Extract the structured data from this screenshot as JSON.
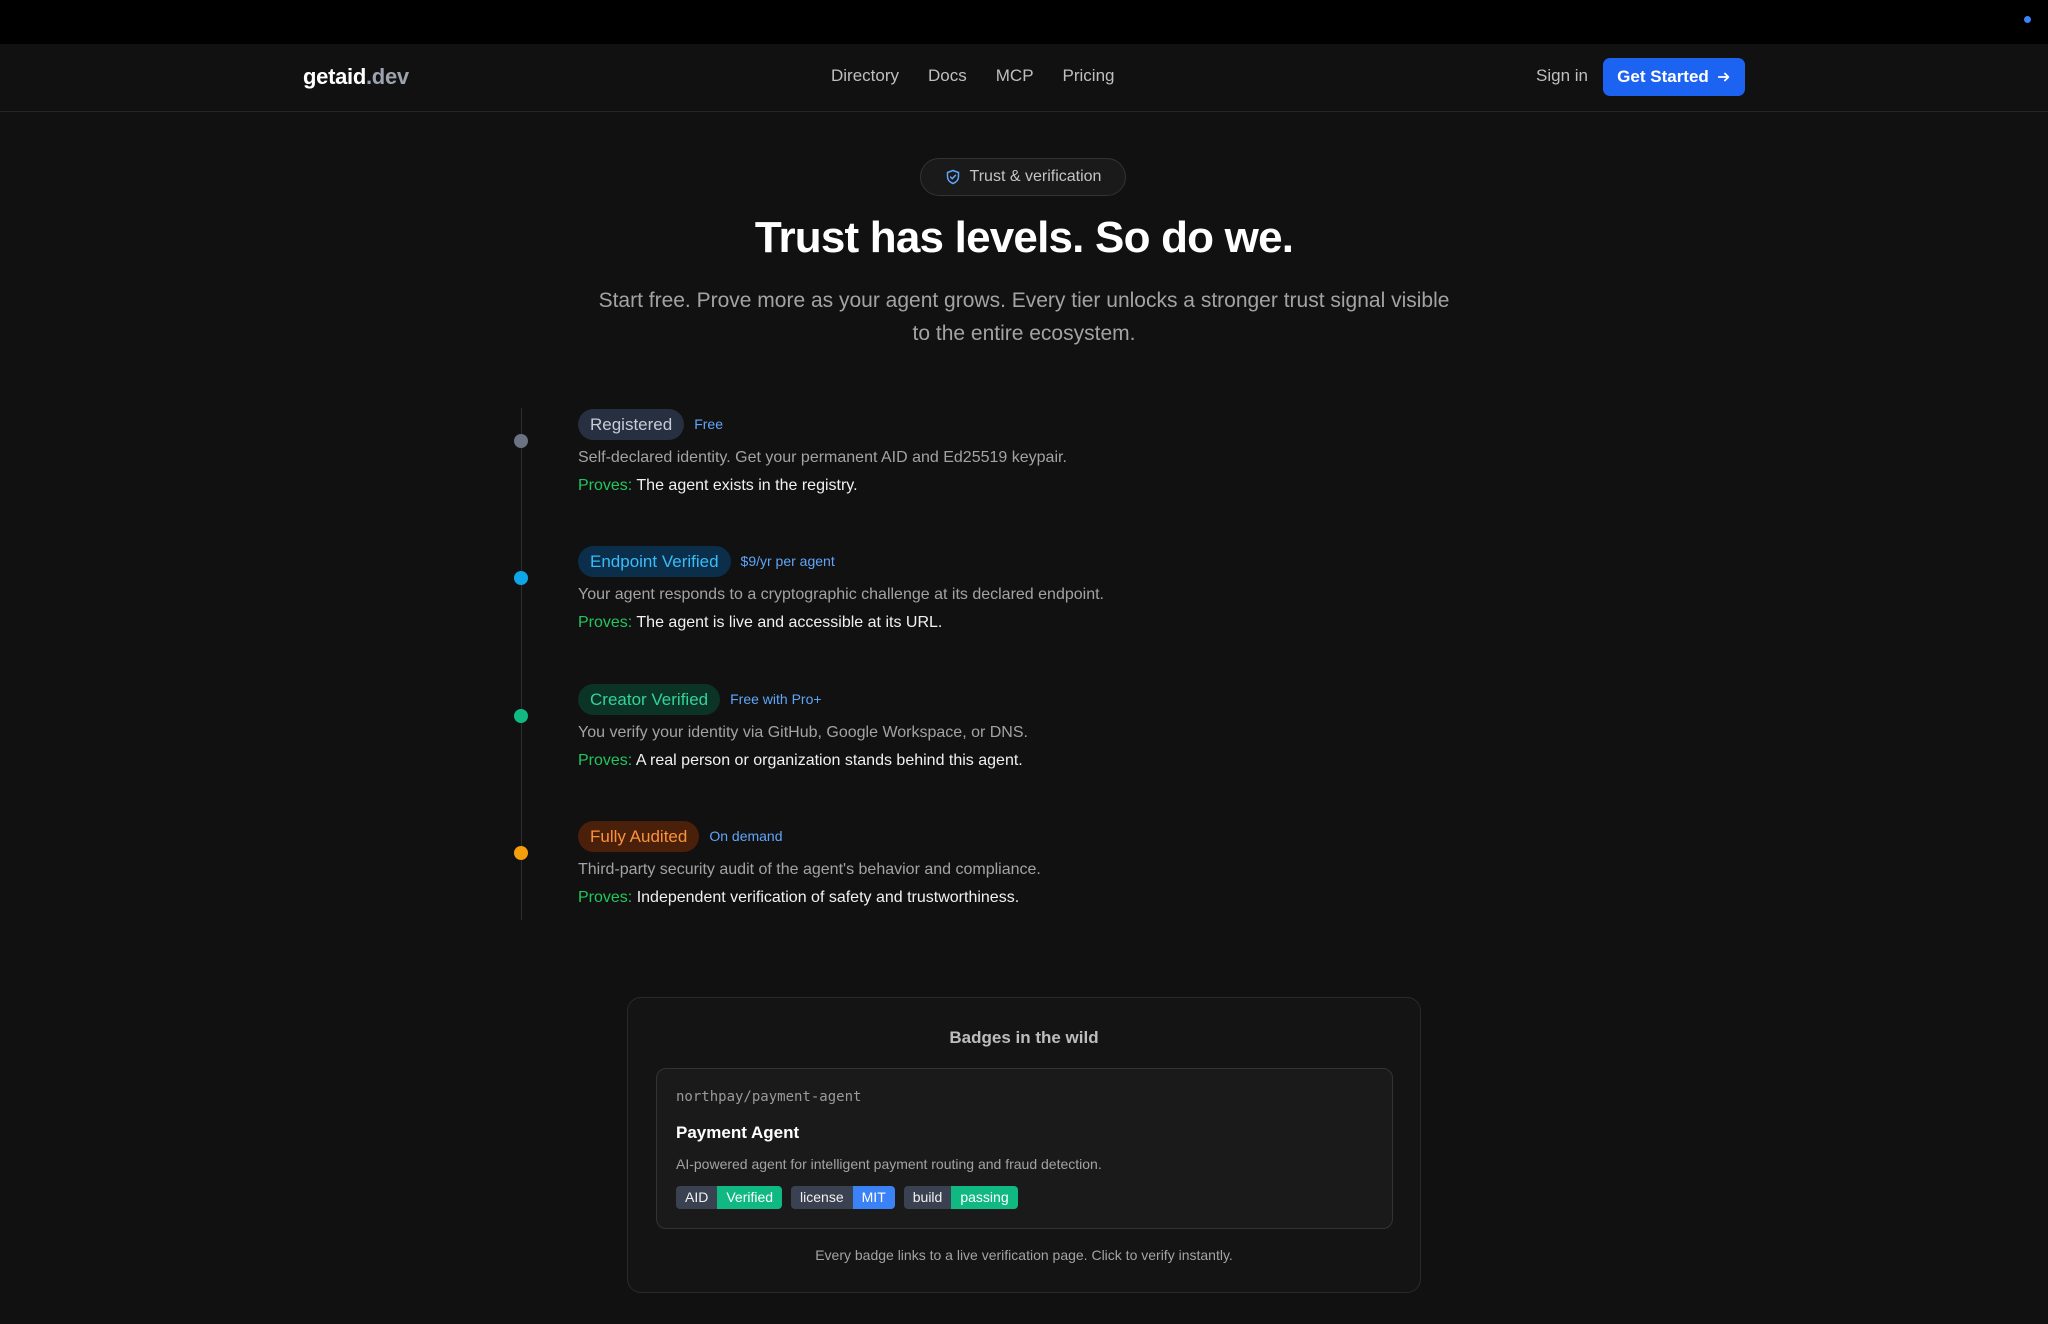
{
  "brand": {
    "name": "getaid",
    "tld": ".dev"
  },
  "nav": {
    "links": [
      "Directory",
      "Docs",
      "MCP",
      "Pricing"
    ],
    "signin": "Sign in",
    "cta": "Get Started",
    "cta_color": "#1d63f2"
  },
  "hero": {
    "pill_icon": "shield-check-icon",
    "pill": "Trust & verification",
    "title": "Trust has levels. So do we.",
    "subtitle_line1": "Start free. Prove more as your agent grows. Every tier unlocks a stronger trust signal visible",
    "subtitle_line2": "to the entire ecosystem."
  },
  "tiers": [
    {
      "name": "Registered",
      "price": "Free",
      "desc": "Self-declared identity. Get your permanent AID and Ed25519 keypair.",
      "proves_label": "Proves:",
      "proves": "The agent exists in the registry.",
      "dot_color": "#6b7280",
      "badge_bg": "#273041",
      "badge_fg": "#c7ccd6"
    },
    {
      "name": "Endpoint Verified",
      "price": "$9/yr per agent",
      "desc": "Your agent responds to a cryptographic challenge at its declared endpoint.",
      "proves_label": "Proves:",
      "proves": "The agent is live and accessible at its URL.",
      "dot_color": "#0ea5e9",
      "badge_bg": "#0b2e4a",
      "badge_fg": "#38bdf8"
    },
    {
      "name": "Creator Verified",
      "price": "Free with Pro+",
      "desc": "You verify your identity via GitHub, Google Workspace, or DNS.",
      "proves_label": "Proves:",
      "proves": "A real person or organization stands behind this agent.",
      "dot_color": "#10b981",
      "badge_bg": "#0b3326",
      "badge_fg": "#34d399"
    },
    {
      "name": "Fully Audited",
      "price": "On demand",
      "desc": "Third-party security audit of the agent's behavior and compliance.",
      "proves_label": "Proves:",
      "proves": "Independent verification of safety and trustworthiness.",
      "dot_color": "#f59e0b",
      "badge_bg": "#4a200b",
      "badge_fg": "#fb923c"
    }
  ],
  "showcase": {
    "title": "Badges in the wild",
    "repo": "northpay/payment-agent",
    "agent_name": "Payment Agent",
    "agent_desc": "AI-powered agent for intelligent payment routing and fraud detection.",
    "badges": [
      {
        "key": "AID",
        "value": "Verified",
        "color": "#10b981"
      },
      {
        "key": "license",
        "value": "MIT",
        "color": "#3b82f6"
      },
      {
        "key": "build",
        "value": "passing",
        "color": "#10b981"
      }
    ],
    "footer": "Every badge links to a live verification page. Click to verify instantly."
  }
}
